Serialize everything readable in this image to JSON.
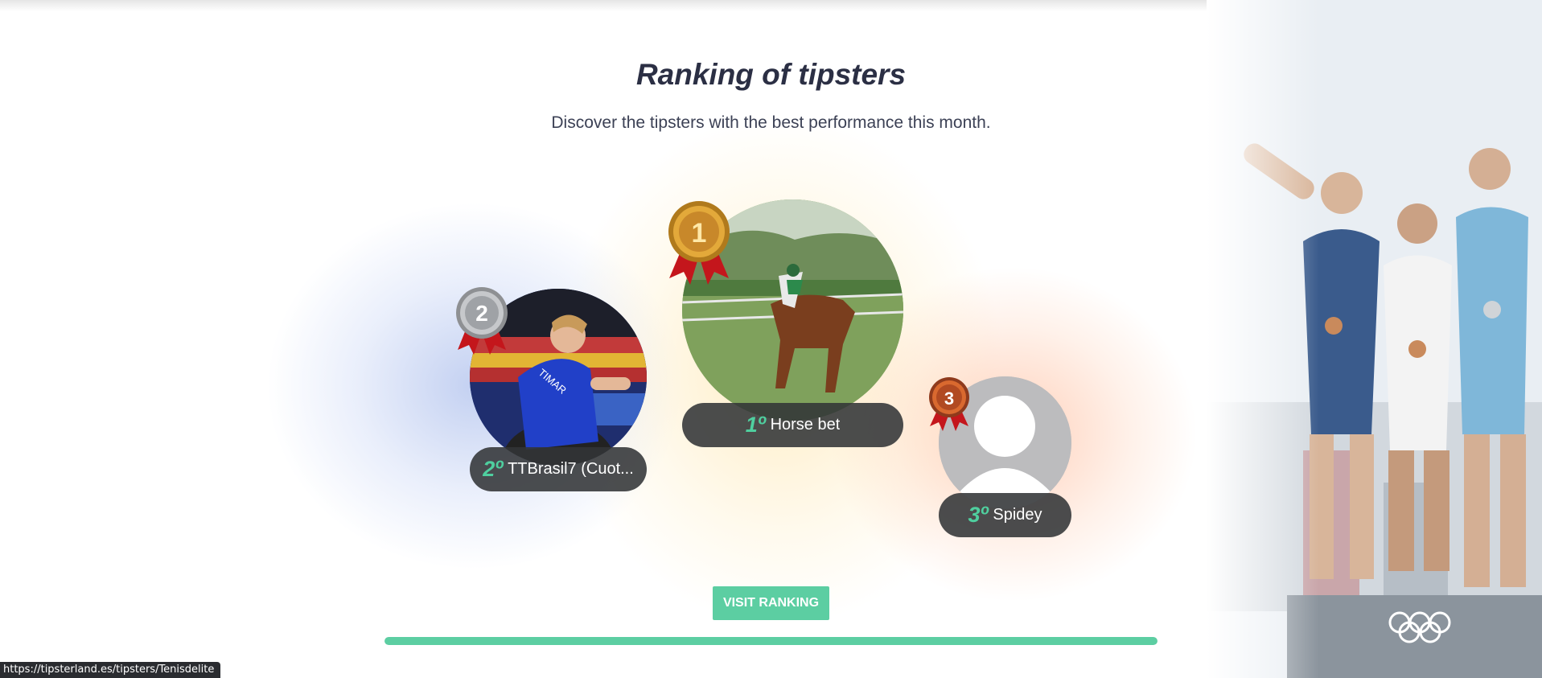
{
  "section": {
    "title": "Ranking of tipsters",
    "subtitle": "Discover the tipsters with the best performance this month."
  },
  "podium": [
    {
      "rank": 2,
      "rank_label": "2º",
      "name": "TTBrasil7 (Cuot...",
      "medal_number": "2",
      "medal_color": "silver",
      "photo": "table-tennis-player-icon"
    },
    {
      "rank": 1,
      "rank_label": "1º",
      "name": "Horse bet",
      "medal_number": "1",
      "medal_color": "gold",
      "photo": "horse-racing-icon"
    },
    {
      "rank": 3,
      "rank_label": "3º",
      "name": "Spidey",
      "medal_number": "3",
      "medal_color": "bronze",
      "photo": "default-avatar-icon"
    }
  ],
  "cta": {
    "label": "VISIT RANKING"
  },
  "progress": {
    "fraction": 1.0
  },
  "status_bar": {
    "url": "https://tipsterland.es/tipsters/Tenisdelite"
  },
  "colors": {
    "accent": "#5ccea2",
    "title": "#2b2f44",
    "pill_bg": "#323437",
    "gold": "#d89a2a",
    "silver": "#a9abae",
    "bronze": "#c2572e",
    "ribbon": "#c4161c"
  }
}
